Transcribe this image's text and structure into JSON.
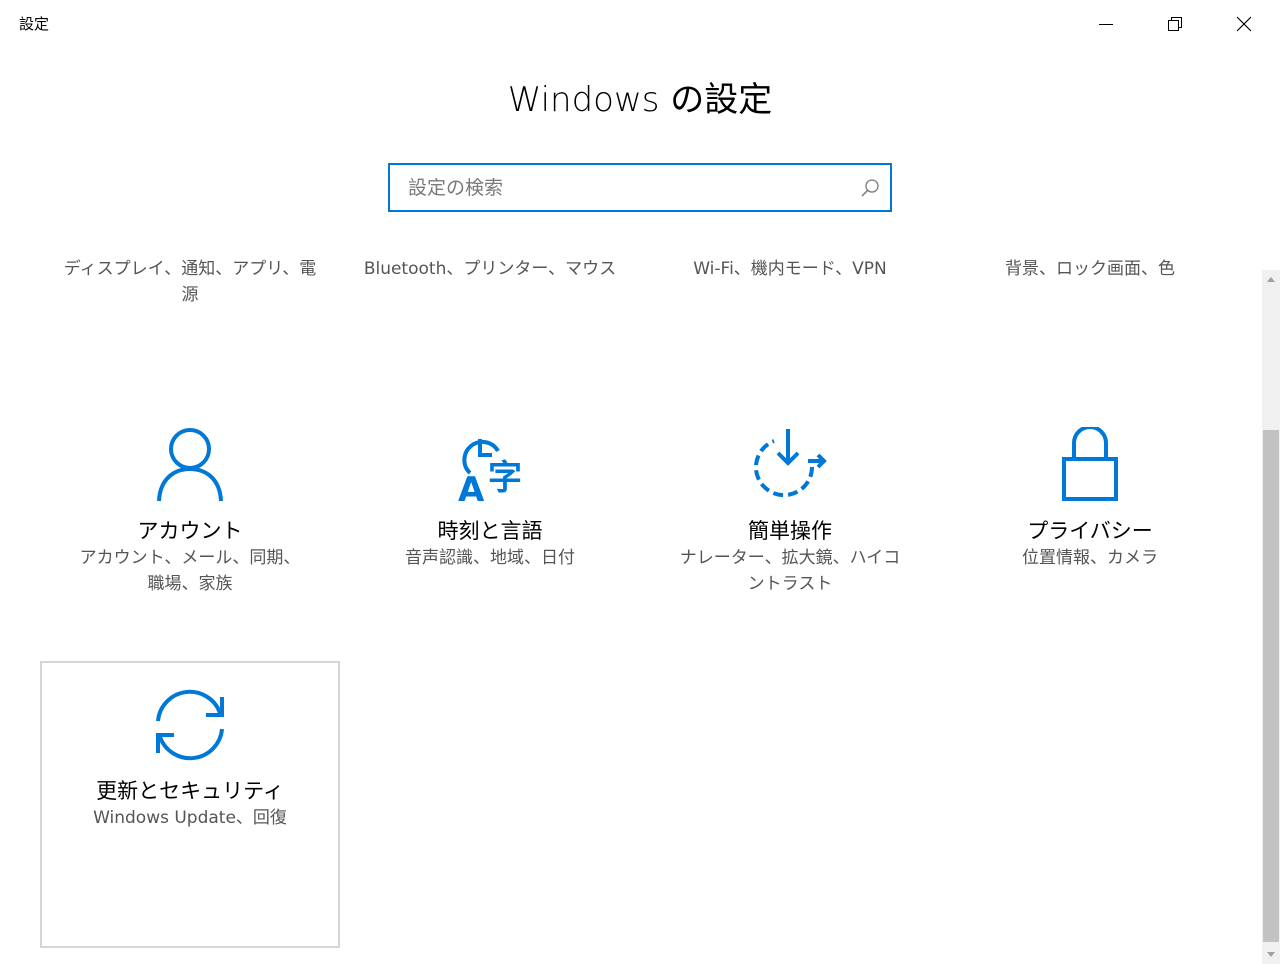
{
  "window": {
    "title": "設定",
    "controls": {
      "minimize": "minimize-icon",
      "restore": "restore-icon",
      "close": "close-icon"
    }
  },
  "header": {
    "title": "Windows の設定"
  },
  "search": {
    "placeholder": "設定の検索",
    "value": "",
    "icon": "search-icon"
  },
  "clipped_row": [
    {
      "desc": "ディスプレイ、通知、アプリ、電源"
    },
    {
      "desc": "Bluetooth、プリンター、マウス"
    },
    {
      "desc": "Wi-Fi、機内モード、VPN"
    },
    {
      "desc": "背景、ロック画面、色"
    }
  ],
  "tiles": [
    {
      "icon": "person-icon",
      "name": "アカウント",
      "desc": "アカウント、メール、同期、職場、家族"
    },
    {
      "icon": "time-language-icon",
      "name": "時刻と言語",
      "desc": "音声認識、地域、日付"
    },
    {
      "icon": "ease-of-access-icon",
      "name": "簡単操作",
      "desc": "ナレーター、拡大鏡、ハイコントラスト"
    },
    {
      "icon": "lock-icon",
      "name": "プライバシー",
      "desc": "位置情報、カメラ"
    },
    {
      "icon": "update-sync-icon",
      "name": "更新とセキュリティ",
      "desc": "Windows Update、回復"
    }
  ],
  "colors": {
    "accent": "#0078d7",
    "focus_border": "#d6d6d6",
    "secondary_text": "#555555"
  }
}
